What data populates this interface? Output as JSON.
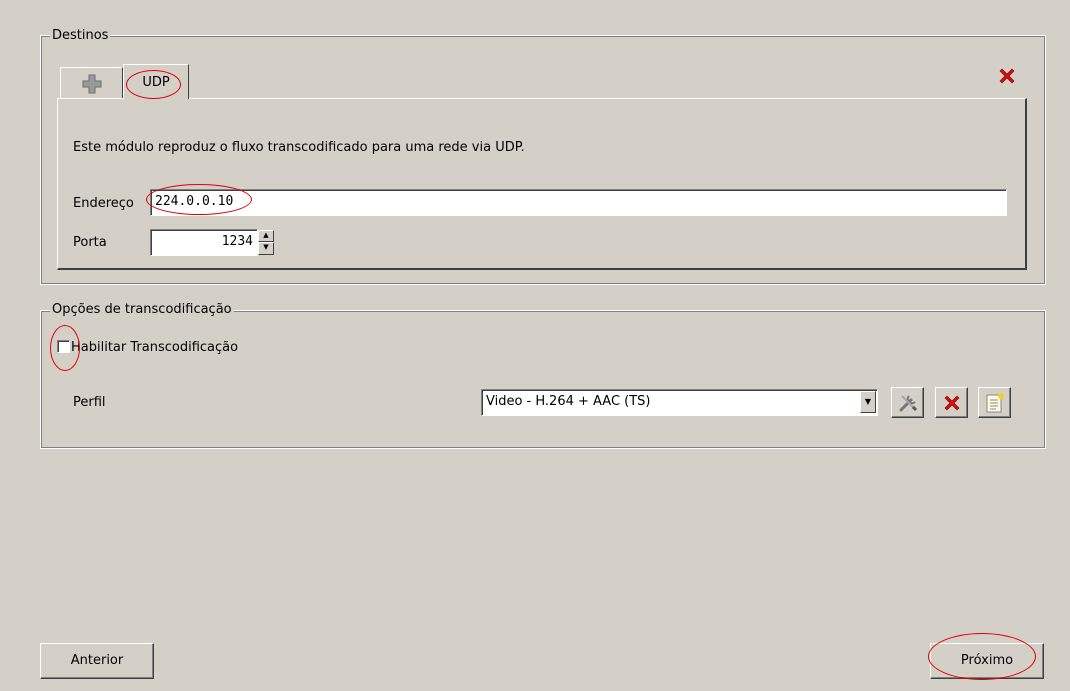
{
  "destinations": {
    "legend": "Destinos",
    "add_tab_icon": "plus-icon",
    "active_tab": "UDP",
    "remove_icon": "close-icon",
    "description": "Este módulo reproduz o fluxo transcodificado para uma rede via UDP.",
    "address_label": "Endereço",
    "address_value": "224.0.0.10",
    "port_label": "Porta",
    "port_value": "1234"
  },
  "transcoding": {
    "legend": "Opções de transcodificação",
    "enable_label": "Habilitar Transcodificação",
    "enable_checked": false,
    "profile_label": "Perfil",
    "profile_selected": "Video - H.264 + AAC (TS)",
    "edit_icon": "tools-icon",
    "delete_icon": "close-icon",
    "new_icon": "new-profile-icon"
  },
  "footer": {
    "back_label": "Anterior",
    "next_label": "Próximo"
  },
  "colors": {
    "background": "#d4d0c8",
    "highlight_annotation": "#e00000",
    "delete_red": "#d01010"
  }
}
